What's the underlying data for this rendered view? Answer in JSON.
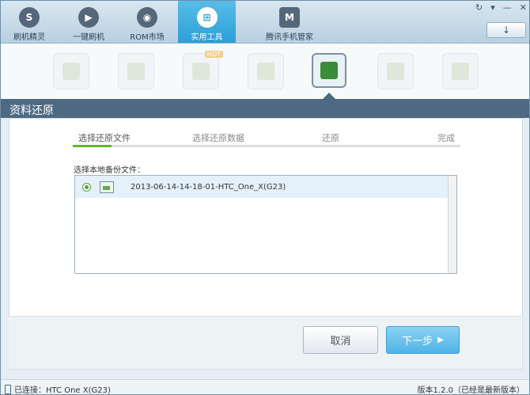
{
  "topbar": {
    "tabs": [
      {
        "label": "刷机精灵",
        "icon": "brush-logo-icon"
      },
      {
        "label": "一键刷机",
        "icon": "play-icon"
      },
      {
        "label": "ROM市场",
        "icon": "android-icon"
      },
      {
        "label": "实用工具",
        "icon": "grid-icon",
        "active": true
      },
      {
        "label": "腾讯手机管家",
        "icon": "shield-m-icon"
      }
    ],
    "window_controls": [
      "↻",
      "▾",
      "—",
      "✕"
    ],
    "sync_label": "↓"
  },
  "tools": {
    "items": [
      "bag-icon",
      "puzzle-icon",
      "shield-icon",
      "files-icon",
      "restore-icon",
      "settings-icon",
      "app-settings-icon"
    ],
    "active_index": 4,
    "hot_badge": "HOT"
  },
  "section": {
    "title": "资料还原"
  },
  "wizard": {
    "steps": [
      "选择还原文件",
      "选择还原数据",
      "还原",
      "完成"
    ],
    "current_step": 0,
    "progress_fraction": 0.1
  },
  "file_list": {
    "label": "选择本地备份文件：",
    "items": [
      {
        "name": "2013-06-14-14-18-01-HTC_One_X(G23)",
        "selected": true
      }
    ]
  },
  "buttons": {
    "cancel": "取消",
    "next": "下一步"
  },
  "status": {
    "connected": "已连接：HTC One X(G23)",
    "version": "版本1.2.0（已经是最新版本）"
  },
  "colors": {
    "accent_blue": "#2d9ed7",
    "section_header": "#4e6a82",
    "progress_green": "#69b22d"
  }
}
